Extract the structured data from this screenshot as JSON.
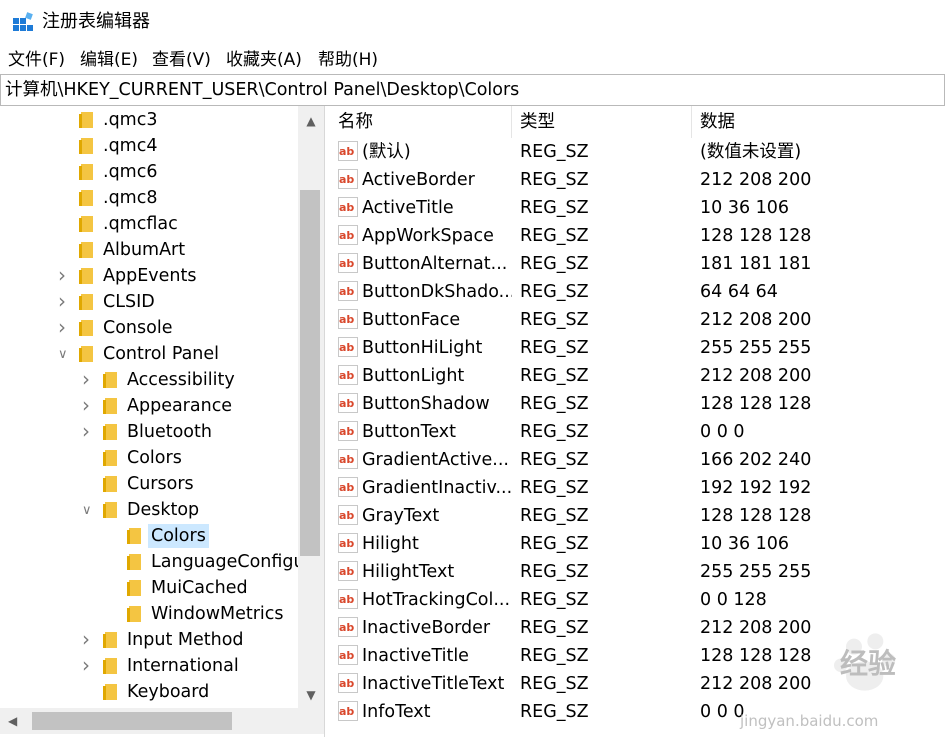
{
  "window": {
    "title": "注册表编辑器"
  },
  "menu": [
    "文件(F)",
    "编辑(E)",
    "查看(V)",
    "收藏夹(A)",
    "帮助(H)"
  ],
  "address": "计算机\\HKEY_CURRENT_USER\\Control Panel\\Desktop\\Colors",
  "tree": [
    {
      "label": ".qmc3",
      "level": 1,
      "expander": ""
    },
    {
      "label": ".qmc4",
      "level": 1,
      "expander": ""
    },
    {
      "label": ".qmc6",
      "level": 1,
      "expander": ""
    },
    {
      "label": ".qmc8",
      "level": 1,
      "expander": ""
    },
    {
      "label": ".qmcflac",
      "level": 1,
      "expander": ""
    },
    {
      "label": "AlbumArt",
      "level": 1,
      "expander": ""
    },
    {
      "label": "AppEvents",
      "level": 1,
      "expander": "collapsed"
    },
    {
      "label": "CLSID",
      "level": 1,
      "expander": "collapsed"
    },
    {
      "label": "Console",
      "level": 1,
      "expander": "collapsed"
    },
    {
      "label": "Control Panel",
      "level": 1,
      "expander": "expanded"
    },
    {
      "label": "Accessibility",
      "level": 2,
      "expander": "collapsed"
    },
    {
      "label": "Appearance",
      "level": 2,
      "expander": "collapsed"
    },
    {
      "label": "Bluetooth",
      "level": 2,
      "expander": "collapsed"
    },
    {
      "label": "Colors",
      "level": 2,
      "expander": ""
    },
    {
      "label": "Cursors",
      "level": 2,
      "expander": ""
    },
    {
      "label": "Desktop",
      "level": 2,
      "expander": "expanded"
    },
    {
      "label": "Colors",
      "level": 3,
      "expander": "",
      "selected": true
    },
    {
      "label": "LanguageConfigu",
      "level": 3,
      "expander": ""
    },
    {
      "label": "MuiCached",
      "level": 3,
      "expander": ""
    },
    {
      "label": "WindowMetrics",
      "level": 3,
      "expander": ""
    },
    {
      "label": "Input Method",
      "level": 2,
      "expander": "collapsed"
    },
    {
      "label": "International",
      "level": 2,
      "expander": "collapsed"
    },
    {
      "label": "Keyboard",
      "level": 2,
      "expander": ""
    }
  ],
  "columns": {
    "name": "名称",
    "type": "类型",
    "data": "数据"
  },
  "values": [
    {
      "name": "(默认)",
      "type": "REG_SZ",
      "data": "(数值未设置)"
    },
    {
      "name": "ActiveBorder",
      "type": "REG_SZ",
      "data": "212 208 200"
    },
    {
      "name": "ActiveTitle",
      "type": "REG_SZ",
      "data": "10 36 106"
    },
    {
      "name": "AppWorkSpace",
      "type": "REG_SZ",
      "data": "128 128 128"
    },
    {
      "name": "ButtonAlternat...",
      "type": "REG_SZ",
      "data": "181 181 181"
    },
    {
      "name": "ButtonDkShado...",
      "type": "REG_SZ",
      "data": "64 64 64"
    },
    {
      "name": "ButtonFace",
      "type": "REG_SZ",
      "data": "212 208 200"
    },
    {
      "name": "ButtonHiLight",
      "type": "REG_SZ",
      "data": "255 255 255"
    },
    {
      "name": "ButtonLight",
      "type": "REG_SZ",
      "data": "212 208 200"
    },
    {
      "name": "ButtonShadow",
      "type": "REG_SZ",
      "data": "128 128 128"
    },
    {
      "name": "ButtonText",
      "type": "REG_SZ",
      "data": "0 0 0"
    },
    {
      "name": "GradientActive...",
      "type": "REG_SZ",
      "data": "166 202 240"
    },
    {
      "name": "GradientInactiv...",
      "type": "REG_SZ",
      "data": "192 192 192"
    },
    {
      "name": "GrayText",
      "type": "REG_SZ",
      "data": "128 128 128"
    },
    {
      "name": "Hilight",
      "type": "REG_SZ",
      "data": "10 36 106"
    },
    {
      "name": "HilightText",
      "type": "REG_SZ",
      "data": "255 255 255"
    },
    {
      "name": "HotTrackingCol...",
      "type": "REG_SZ",
      "data": "0 0 128"
    },
    {
      "name": "InactiveBorder",
      "type": "REG_SZ",
      "data": "212 208 200"
    },
    {
      "name": "InactiveTitle",
      "type": "REG_SZ",
      "data": "128 128 128"
    },
    {
      "name": "InactiveTitleText",
      "type": "REG_SZ",
      "data": "212 208 200"
    },
    {
      "name": "InfoText",
      "type": "REG_SZ",
      "data": "0 0 0"
    }
  ],
  "watermark": {
    "text": "经验",
    "url": "jingyan.baidu.com"
  },
  "colors": {
    "folder": "#f4c542",
    "selection": "#cce8ff",
    "ab_icon": "#d9472b"
  }
}
